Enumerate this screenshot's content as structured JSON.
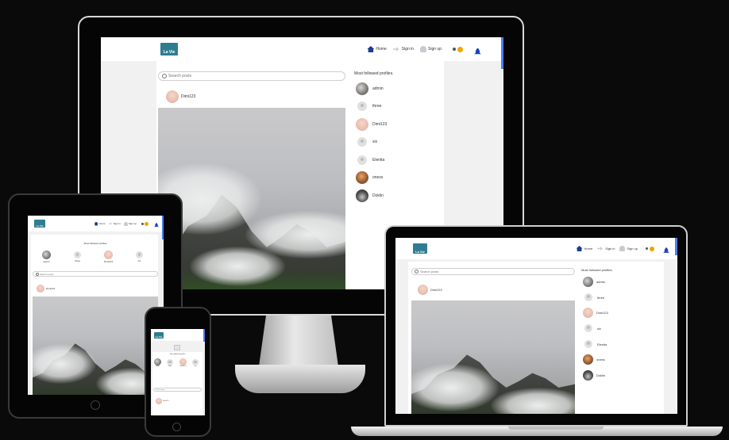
{
  "brand": {
    "logo_text": "La Vie",
    "accent": "#2f7d91"
  },
  "nav": {
    "home_label": "Home",
    "signin_label": "Sign in",
    "signup_label": "Sign up",
    "home_icon": "house-icon",
    "signin_icon": "sign-in-icon",
    "signup_icon": "user-plus-icon",
    "bell_icon": "bell-icon"
  },
  "search": {
    "placeholder": "Search posts"
  },
  "sidebar": {
    "title": "Most followed profiles.",
    "profiles": [
      "admin",
      "three",
      "Dimi123",
      "six",
      "Elenita",
      "oness",
      "Doklin"
    ]
  },
  "post": {
    "author": "Dimi123"
  },
  "phone": {
    "profiles_row": [
      "admin",
      "three",
      "Dimi12 3",
      "six"
    ]
  },
  "colors": {
    "background": "#0b0a0a",
    "page": "#f1f1f1",
    "link_blue": "#1b3c8f",
    "scrollbar": "#4a7ef0"
  }
}
